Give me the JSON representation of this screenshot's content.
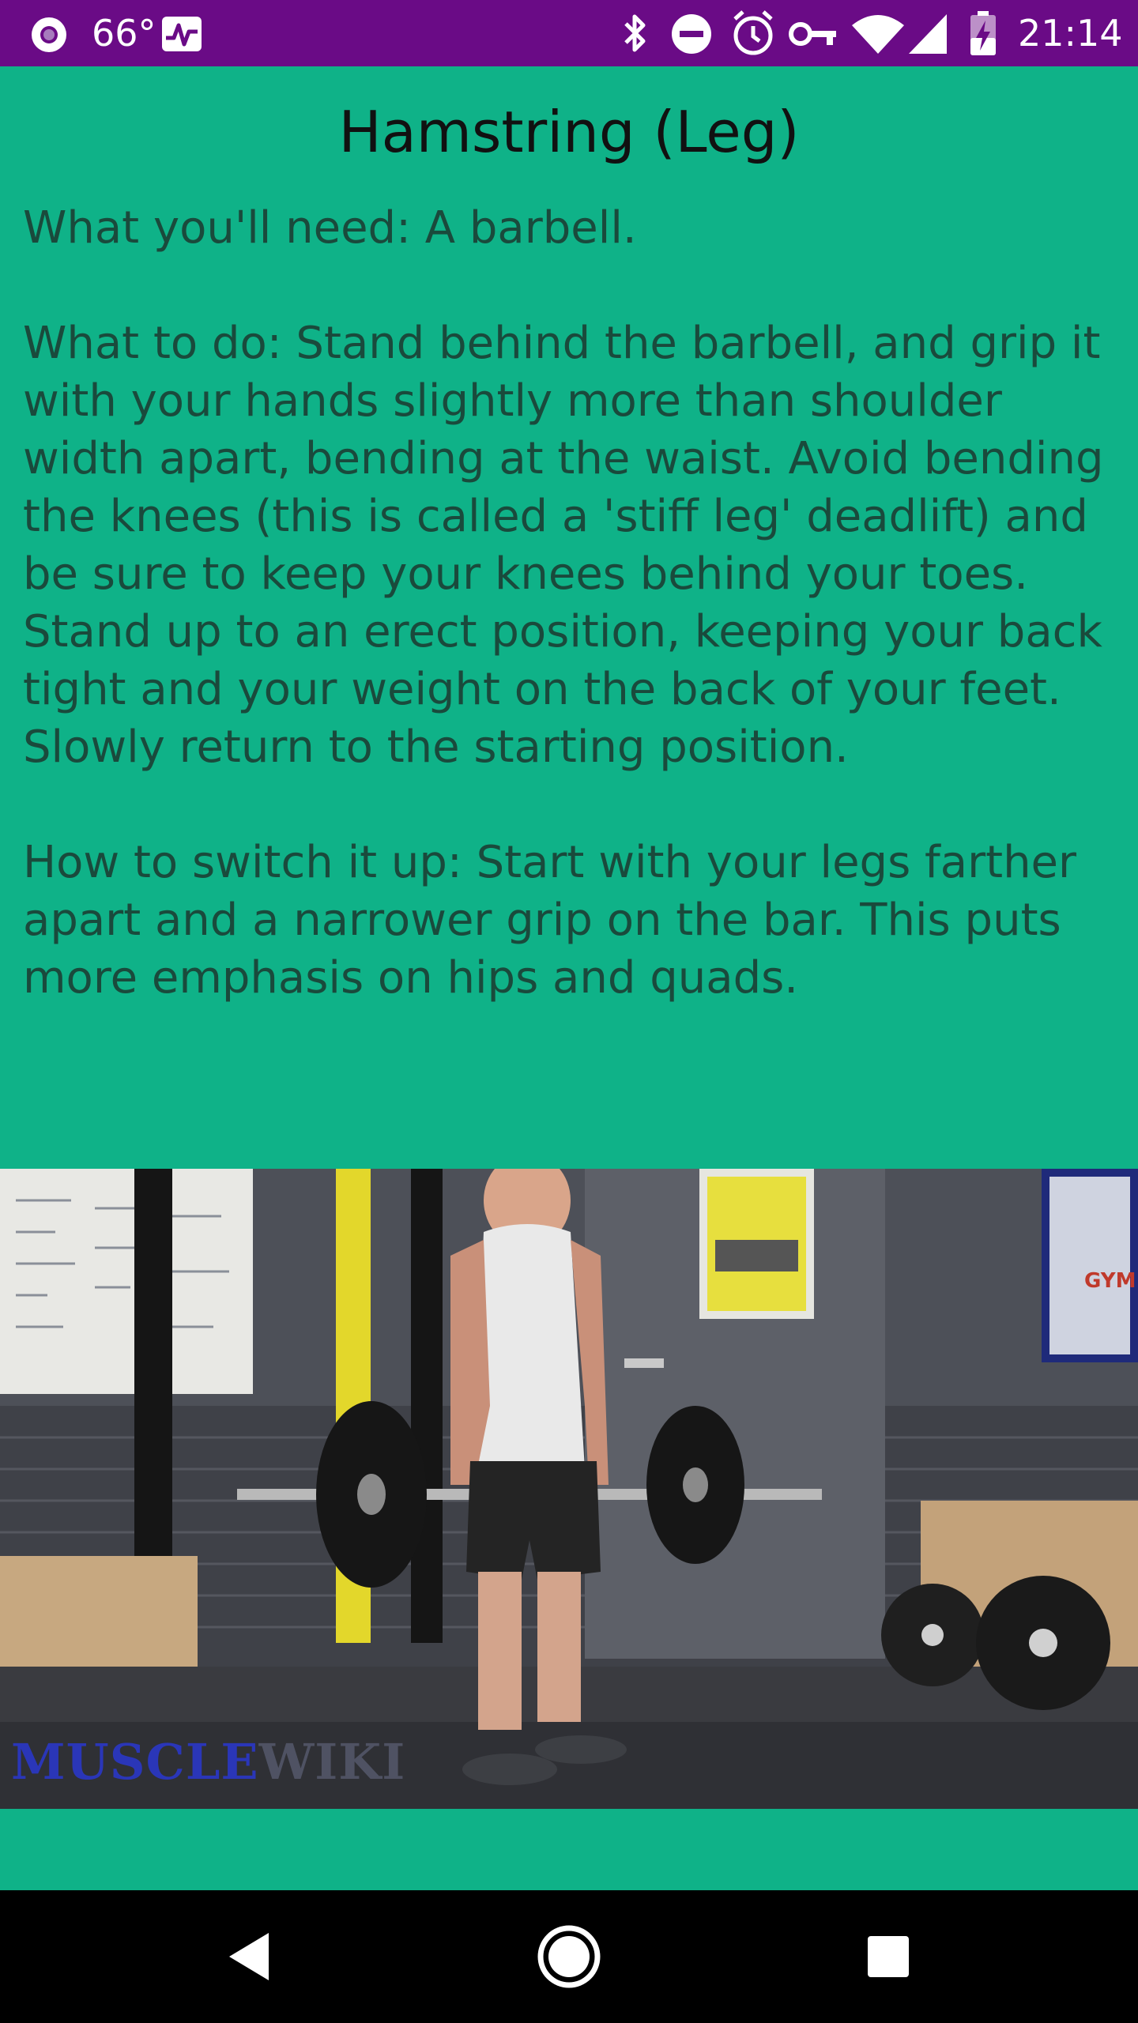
{
  "status_bar": {
    "temperature": "66°",
    "time": "21:14",
    "icons": [
      "record-dot-icon",
      "activity-monitor-icon",
      "bluetooth-icon",
      "do-not-disturb-icon",
      "alarm-icon",
      "vpn-key-icon",
      "wifi-icon",
      "cell-signal-icon",
      "battery-charging-icon"
    ]
  },
  "page": {
    "title": "Hamstring (Leg)",
    "need": "What you'll need: A barbell.",
    "what_to_do": "What to do: Stand behind the barbell, and grip it with your hands slightly more than shoulder width apart, bending at the waist. Avoid bending the knees (this is called a 'stiff leg' deadlift) and be sure to keep your knees behind your toes. Stand up to an erect position, keeping your back tight and your weight on the back of your feet. Slowly return to the starting position.",
    "switch_it_up": "How to switch it up: Start with your legs farther apart and a narrower grip on the bar. This puts more emphasis on hips and quads."
  },
  "image": {
    "watermark_part1": "MUSCLE",
    "watermark_part2": "WIKI",
    "gym_sign": "GYM"
  },
  "nav_bar": {
    "icons": [
      "back-icon",
      "home-icon",
      "recents-icon"
    ]
  },
  "colors": {
    "background": "#0fb288",
    "status_bar": "#6a0b86",
    "body_text": "#1a4a3c",
    "title_text": "#111111"
  }
}
